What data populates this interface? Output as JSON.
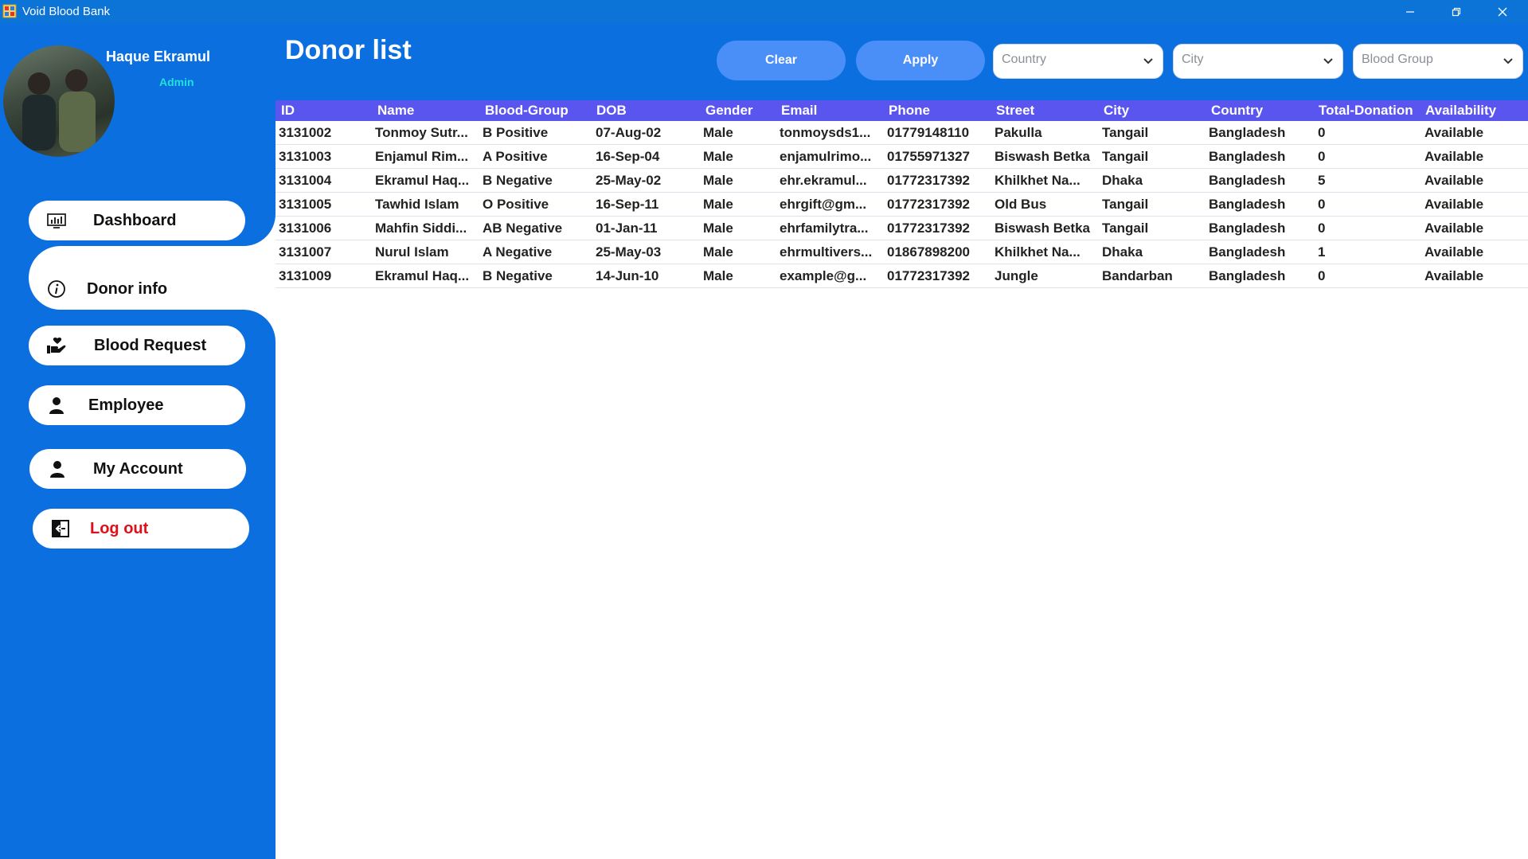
{
  "window": {
    "title": "Void Blood Bank"
  },
  "user": {
    "name": "Haque Ekramul",
    "role": "Admin"
  },
  "sidebar": {
    "items": [
      {
        "label": "Dashboard"
      },
      {
        "label": "Donor info"
      },
      {
        "label": "Blood Request"
      },
      {
        "label": "Employee"
      },
      {
        "label": "My Account"
      },
      {
        "label": "Log out"
      }
    ]
  },
  "header": {
    "title": "Donor list",
    "clear_label": "Clear",
    "apply_label": "Apply",
    "country_placeholder": "Country",
    "city_placeholder": "City",
    "blood_group_placeholder": "Blood Group"
  },
  "colors": {
    "accent": "#0b6fe0",
    "header_row": "#5b55f0",
    "logout": "#e0101a",
    "role": "#22e0d8"
  },
  "table": {
    "columns": [
      "ID",
      "Name",
      "Blood-Group",
      "DOB",
      "Gender",
      "Email",
      "Phone",
      "Street",
      "City",
      "Country",
      "Total-Donation",
      "Availability"
    ],
    "rows": [
      [
        "3131002",
        "Tonmoy Sutr...",
        "B Positive",
        "07-Aug-02",
        "Male",
        "tonmoysds1...",
        "01779148110",
        "Pakulla",
        "Tangail",
        "Bangladesh",
        "0",
        "Available"
      ],
      [
        "3131003",
        "Enjamul Rim...",
        "A Positive",
        "16-Sep-04",
        "Male",
        "enjamulrimo...",
        "01755971327",
        "Biswash Betka",
        "Tangail",
        "Bangladesh",
        "0",
        "Available"
      ],
      [
        "3131004",
        "Ekramul Haq...",
        "B Negative",
        "25-May-02",
        "Male",
        "ehr.ekramul...",
        "01772317392",
        "Khilkhet Na...",
        "Dhaka",
        "Bangladesh",
        "5",
        "Available"
      ],
      [
        "3131005",
        "Tawhid Islam",
        "O Positive",
        "16-Sep-11",
        "Male",
        "ehrgift@gm...",
        "01772317392",
        "Old Bus",
        "Tangail",
        "Bangladesh",
        "0",
        "Available"
      ],
      [
        "3131006",
        "Mahfin Siddi...",
        "AB Negative",
        "01-Jan-11",
        "Male",
        "ehrfamilytra...",
        "01772317392",
        "Biswash Betka",
        "Tangail",
        "Bangladesh",
        "0",
        "Available"
      ],
      [
        "3131007",
        "Nurul Islam",
        "A Negative",
        "25-May-03",
        "Male",
        "ehrmultivers...",
        "01867898200",
        "Khilkhet Na...",
        "Dhaka",
        "Bangladesh",
        "1",
        "Available"
      ],
      [
        "3131009",
        "Ekramul Haq...",
        "B Negative",
        "14-Jun-10",
        "Male",
        "example@g...",
        "01772317392",
        "Jungle",
        "Bandarban",
        "Bangladesh",
        "0",
        "Available"
      ]
    ]
  }
}
